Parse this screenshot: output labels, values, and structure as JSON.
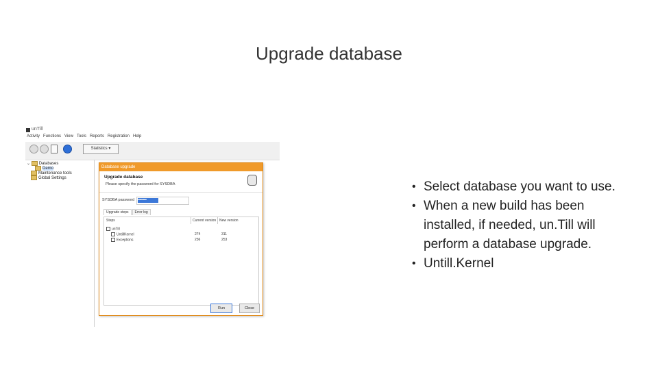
{
  "slide": {
    "title": "Upgrade database",
    "bullets": [
      "Select database you want to use.",
      "When a new build has been installed, if needed, un.Till will perform a database upgrade.",
      "Untill.Kernel"
    ]
  },
  "screenshot": {
    "app_title": "unTill",
    "menu": [
      "Activity",
      "Functions",
      "View",
      "Tools",
      "Reports",
      "Registration",
      "Help"
    ],
    "toolbar_dropdown": "Statistics",
    "tree": [
      "Databases",
      "Demo",
      "Maintenance tools",
      "Global Settings"
    ],
    "dialog": {
      "title": "Database upgrade",
      "heading": "Upgrade database",
      "subheading": "Please specify the password for SYSDBA",
      "password_label": "SYSDBA password",
      "password_value": "••••••••••",
      "tabs": [
        "Upgrade steps",
        "Error log"
      ],
      "columns": [
        "Steps",
        "Current version",
        "New version"
      ],
      "rows": [
        {
          "step": "unTill",
          "current": "",
          "new": ""
        },
        {
          "step": "UntillKernel",
          "current": "274",
          "new": "311"
        },
        {
          "step": "Exceptions",
          "current": "236",
          "new": "253"
        }
      ],
      "run_label": "Run",
      "close_label": "Close"
    }
  }
}
